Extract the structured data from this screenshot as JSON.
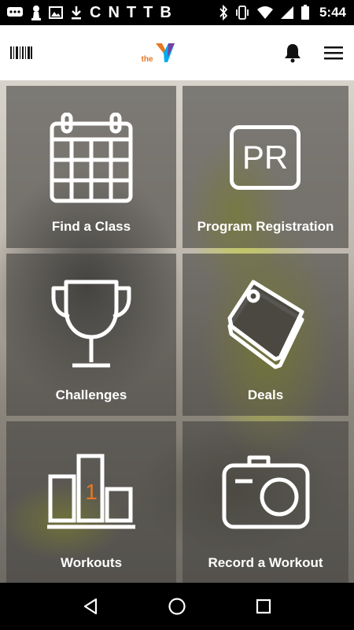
{
  "status_bar": {
    "notification_letters": [
      "C",
      "N",
      "T",
      "T",
      "B"
    ],
    "time": "5:44"
  },
  "app_bar": {
    "logo_text": "the",
    "logo_colors": [
      "#e87722",
      "#00aeef",
      "#92278f"
    ]
  },
  "tiles": [
    {
      "label": "Find a Class",
      "icon": "calendar-icon"
    },
    {
      "label": "Program Registration",
      "icon": "pr-icon",
      "icon_text": "PR"
    },
    {
      "label": "Challenges",
      "icon": "trophy-icon"
    },
    {
      "label": "Deals",
      "icon": "tags-icon"
    },
    {
      "label": "Workouts",
      "icon": "podium-icon",
      "icon_text": "1",
      "icon_text_color": "#e87722"
    },
    {
      "label": "Record a Workout",
      "icon": "camera-icon"
    }
  ],
  "nav_bar": {
    "buttons": [
      "back",
      "home",
      "recents"
    ]
  }
}
